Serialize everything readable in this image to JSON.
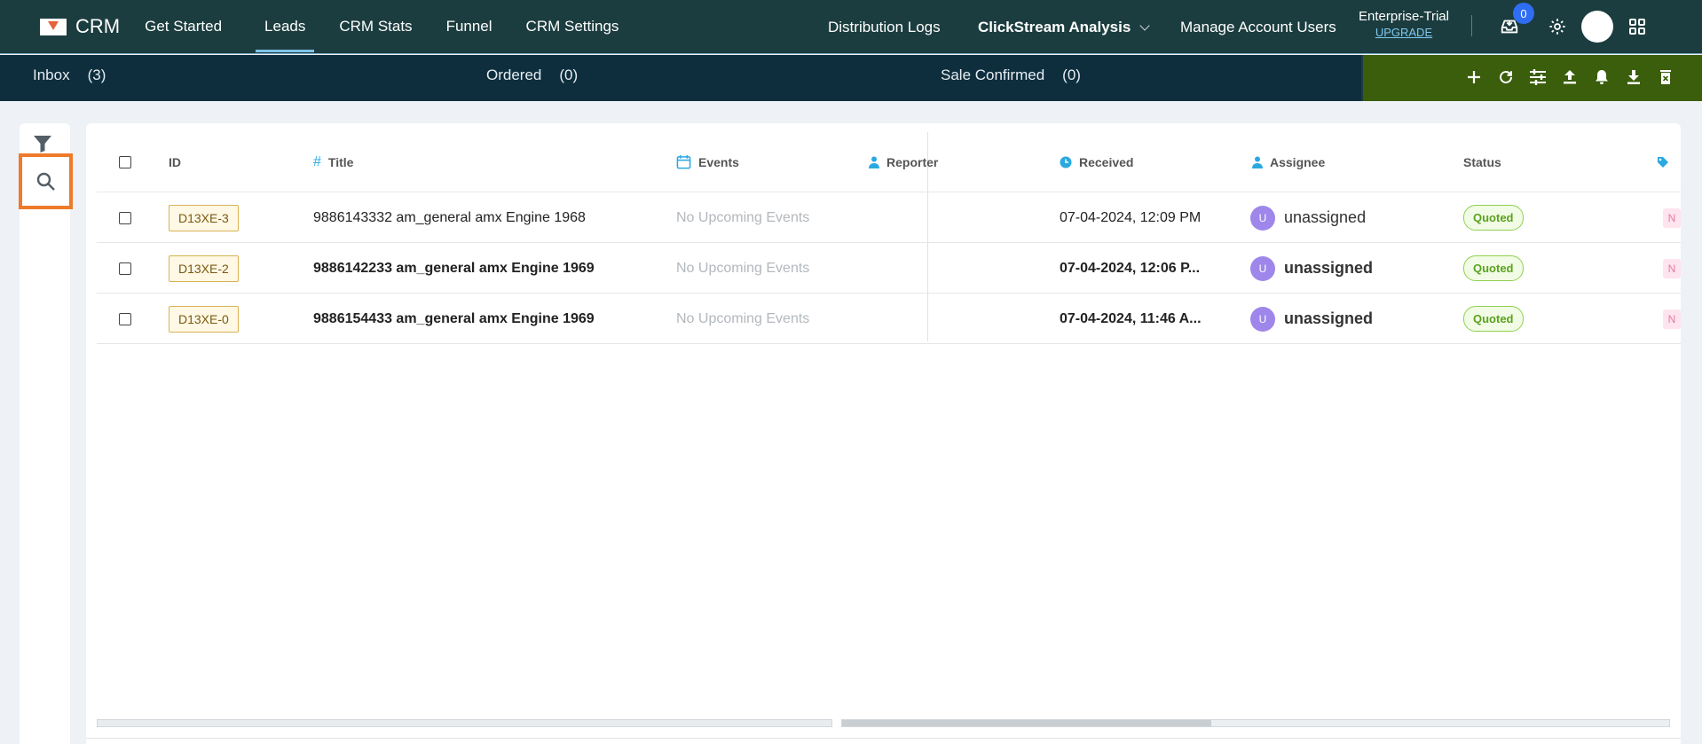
{
  "app": {
    "logo_text": "CRM"
  },
  "nav": {
    "items": [
      "Get Started",
      "Leads",
      "CRM Stats",
      "Funnel",
      "CRM Settings"
    ],
    "active": "Leads",
    "right": {
      "distribution_logs": "Distribution Logs",
      "clickstream": "ClickStream Analysis",
      "manage_users": "Manage Account Users"
    },
    "plan": {
      "name": "Enterprise-Trial",
      "upgrade": "UPGRADE"
    },
    "inbox_badge": "0"
  },
  "subbar": {
    "tabs": [
      {
        "label": "Inbox",
        "count": "(3)"
      },
      {
        "label": "Ordered",
        "count": "(0)"
      },
      {
        "label": "Sale Confirmed",
        "count": "(0)"
      }
    ]
  },
  "table": {
    "headers": {
      "id": "ID",
      "title": "Title",
      "events": "Events",
      "reporter": "Reporter",
      "received": "Received",
      "assignee": "Assignee",
      "status": "Status"
    },
    "rows": [
      {
        "id": "D13XE-3",
        "title": "9886143332 am_general amx Engine 1968",
        "events": "No Upcoming Events",
        "received": "07-04-2024, 12:09 PM",
        "avatar": "U",
        "assignee": "unassigned",
        "status": "Quoted",
        "tag": "N"
      },
      {
        "id": "D13XE-2",
        "title": "9886142233 am_general amx Engine 1969",
        "events": "No Upcoming Events",
        "received": "07-04-2024, 12:06 P...",
        "avatar": "U",
        "assignee": "unassigned",
        "status": "Quoted",
        "tag": "N"
      },
      {
        "id": "D13XE-0",
        "title": "9886154433 am_general amx Engine 1969",
        "events": "No Upcoming Events",
        "received": "07-04-2024, 11:46 A...",
        "avatar": "U",
        "assignee": "unassigned",
        "status": "Quoted",
        "tag": "N"
      }
    ]
  },
  "colors": {
    "topnav": "#1c3d3f",
    "subbar": "#0e2e3e",
    "toolbar": "#3a5e0c",
    "highlight": "#ee7a2a",
    "status": "#8fd14f"
  },
  "icons": {
    "toolbar": [
      "plus-icon",
      "refresh-icon",
      "sliders-icon",
      "upload-icon",
      "bell-icon",
      "download-icon",
      "delete-icon"
    ],
    "side": [
      "filter-icon",
      "search-icon"
    ]
  }
}
